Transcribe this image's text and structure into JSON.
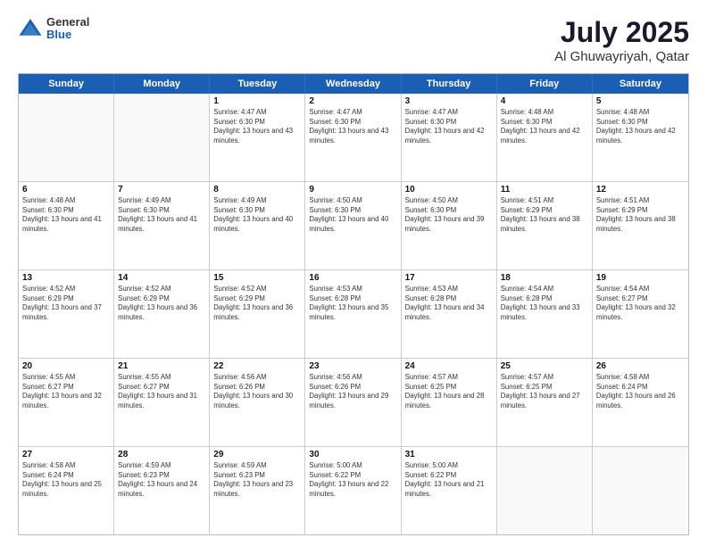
{
  "header": {
    "logo": {
      "general": "General",
      "blue": "Blue"
    },
    "title": "July 2025",
    "subtitle": "Al Ghuwayriyah, Qatar"
  },
  "weekdays": [
    "Sunday",
    "Monday",
    "Tuesday",
    "Wednesday",
    "Thursday",
    "Friday",
    "Saturday"
  ],
  "weeks": [
    [
      {
        "day": "",
        "text": ""
      },
      {
        "day": "",
        "text": ""
      },
      {
        "day": "1",
        "text": "Sunrise: 4:47 AM\nSunset: 6:30 PM\nDaylight: 13 hours and 43 minutes."
      },
      {
        "day": "2",
        "text": "Sunrise: 4:47 AM\nSunset: 6:30 PM\nDaylight: 13 hours and 43 minutes."
      },
      {
        "day": "3",
        "text": "Sunrise: 4:47 AM\nSunset: 6:30 PM\nDaylight: 13 hours and 42 minutes."
      },
      {
        "day": "4",
        "text": "Sunrise: 4:48 AM\nSunset: 6:30 PM\nDaylight: 13 hours and 42 minutes."
      },
      {
        "day": "5",
        "text": "Sunrise: 4:48 AM\nSunset: 6:30 PM\nDaylight: 13 hours and 42 minutes."
      }
    ],
    [
      {
        "day": "6",
        "text": "Sunrise: 4:48 AM\nSunset: 6:30 PM\nDaylight: 13 hours and 41 minutes."
      },
      {
        "day": "7",
        "text": "Sunrise: 4:49 AM\nSunset: 6:30 PM\nDaylight: 13 hours and 41 minutes."
      },
      {
        "day": "8",
        "text": "Sunrise: 4:49 AM\nSunset: 6:30 PM\nDaylight: 13 hours and 40 minutes."
      },
      {
        "day": "9",
        "text": "Sunrise: 4:50 AM\nSunset: 6:30 PM\nDaylight: 13 hours and 40 minutes."
      },
      {
        "day": "10",
        "text": "Sunrise: 4:50 AM\nSunset: 6:30 PM\nDaylight: 13 hours and 39 minutes."
      },
      {
        "day": "11",
        "text": "Sunrise: 4:51 AM\nSunset: 6:29 PM\nDaylight: 13 hours and 38 minutes."
      },
      {
        "day": "12",
        "text": "Sunrise: 4:51 AM\nSunset: 6:29 PM\nDaylight: 13 hours and 38 minutes."
      }
    ],
    [
      {
        "day": "13",
        "text": "Sunrise: 4:52 AM\nSunset: 6:29 PM\nDaylight: 13 hours and 37 minutes."
      },
      {
        "day": "14",
        "text": "Sunrise: 4:52 AM\nSunset: 6:29 PM\nDaylight: 13 hours and 36 minutes."
      },
      {
        "day": "15",
        "text": "Sunrise: 4:52 AM\nSunset: 6:29 PM\nDaylight: 13 hours and 36 minutes."
      },
      {
        "day": "16",
        "text": "Sunrise: 4:53 AM\nSunset: 6:28 PM\nDaylight: 13 hours and 35 minutes."
      },
      {
        "day": "17",
        "text": "Sunrise: 4:53 AM\nSunset: 6:28 PM\nDaylight: 13 hours and 34 minutes."
      },
      {
        "day": "18",
        "text": "Sunrise: 4:54 AM\nSunset: 6:28 PM\nDaylight: 13 hours and 33 minutes."
      },
      {
        "day": "19",
        "text": "Sunrise: 4:54 AM\nSunset: 6:27 PM\nDaylight: 13 hours and 32 minutes."
      }
    ],
    [
      {
        "day": "20",
        "text": "Sunrise: 4:55 AM\nSunset: 6:27 PM\nDaylight: 13 hours and 32 minutes."
      },
      {
        "day": "21",
        "text": "Sunrise: 4:55 AM\nSunset: 6:27 PM\nDaylight: 13 hours and 31 minutes."
      },
      {
        "day": "22",
        "text": "Sunrise: 4:56 AM\nSunset: 6:26 PM\nDaylight: 13 hours and 30 minutes."
      },
      {
        "day": "23",
        "text": "Sunrise: 4:56 AM\nSunset: 6:26 PM\nDaylight: 13 hours and 29 minutes."
      },
      {
        "day": "24",
        "text": "Sunrise: 4:57 AM\nSunset: 6:25 PM\nDaylight: 13 hours and 28 minutes."
      },
      {
        "day": "25",
        "text": "Sunrise: 4:57 AM\nSunset: 6:25 PM\nDaylight: 13 hours and 27 minutes."
      },
      {
        "day": "26",
        "text": "Sunrise: 4:58 AM\nSunset: 6:24 PM\nDaylight: 13 hours and 26 minutes."
      }
    ],
    [
      {
        "day": "27",
        "text": "Sunrise: 4:58 AM\nSunset: 6:24 PM\nDaylight: 13 hours and 25 minutes."
      },
      {
        "day": "28",
        "text": "Sunrise: 4:59 AM\nSunset: 6:23 PM\nDaylight: 13 hours and 24 minutes."
      },
      {
        "day": "29",
        "text": "Sunrise: 4:59 AM\nSunset: 6:23 PM\nDaylight: 13 hours and 23 minutes."
      },
      {
        "day": "30",
        "text": "Sunrise: 5:00 AM\nSunset: 6:22 PM\nDaylight: 13 hours and 22 minutes."
      },
      {
        "day": "31",
        "text": "Sunrise: 5:00 AM\nSunset: 6:22 PM\nDaylight: 13 hours and 21 minutes."
      },
      {
        "day": "",
        "text": ""
      },
      {
        "day": "",
        "text": ""
      }
    ]
  ]
}
